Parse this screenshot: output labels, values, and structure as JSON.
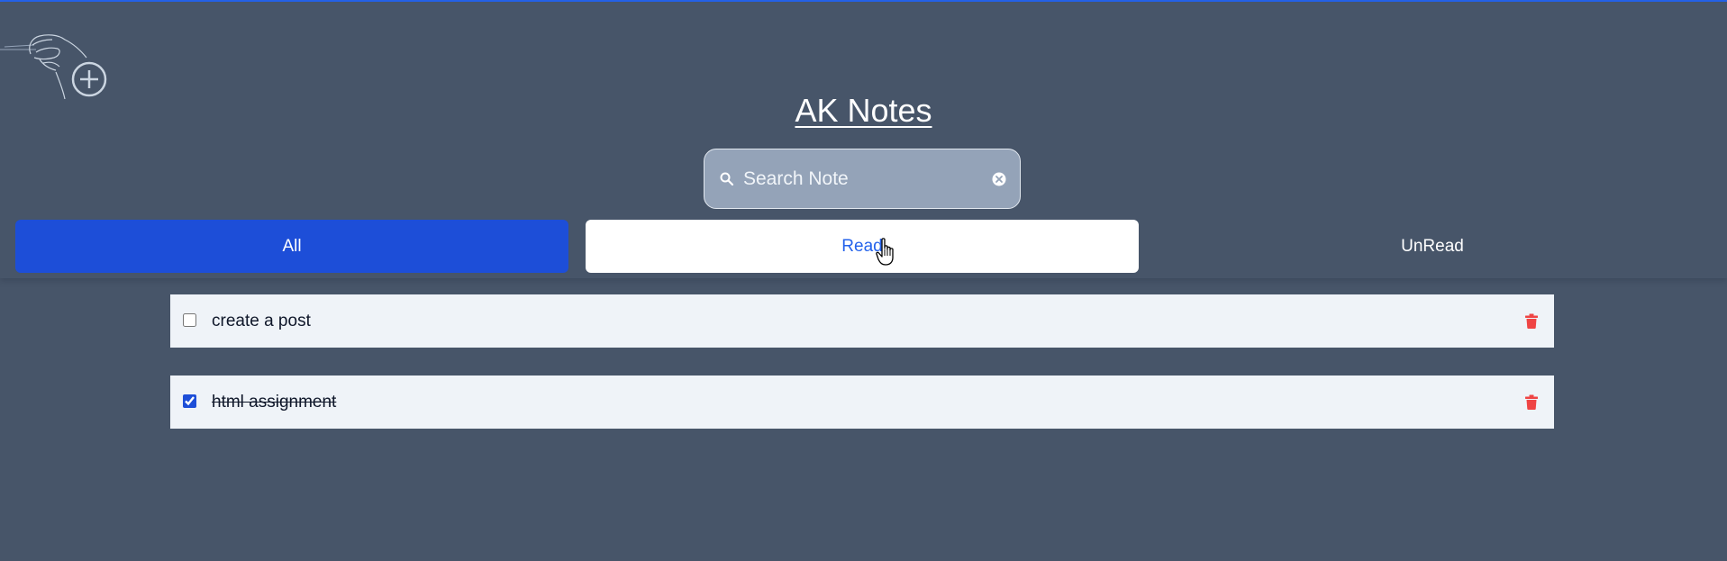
{
  "app": {
    "title": "AK Notes"
  },
  "logo": {
    "icon": "hand-plus-icon"
  },
  "search": {
    "placeholder": "Search Note",
    "value": "",
    "icon": "search-icon",
    "clear_icon": "clear-icon"
  },
  "tabs": [
    {
      "label": "All",
      "active": true
    },
    {
      "label": "Read",
      "active": false,
      "hovered": true
    },
    {
      "label": "UnRead",
      "active": false
    }
  ],
  "notes": [
    {
      "text": "create a post",
      "checked": false,
      "delete_icon": "trash-icon"
    },
    {
      "text": "html assignment",
      "checked": true,
      "delete_icon": "trash-icon"
    }
  ],
  "colors": {
    "background": "#475569",
    "accent": "#1d4ed8",
    "delete": "#ef4444",
    "note_bg": "#eff3f8",
    "top_border": "#2563eb"
  }
}
